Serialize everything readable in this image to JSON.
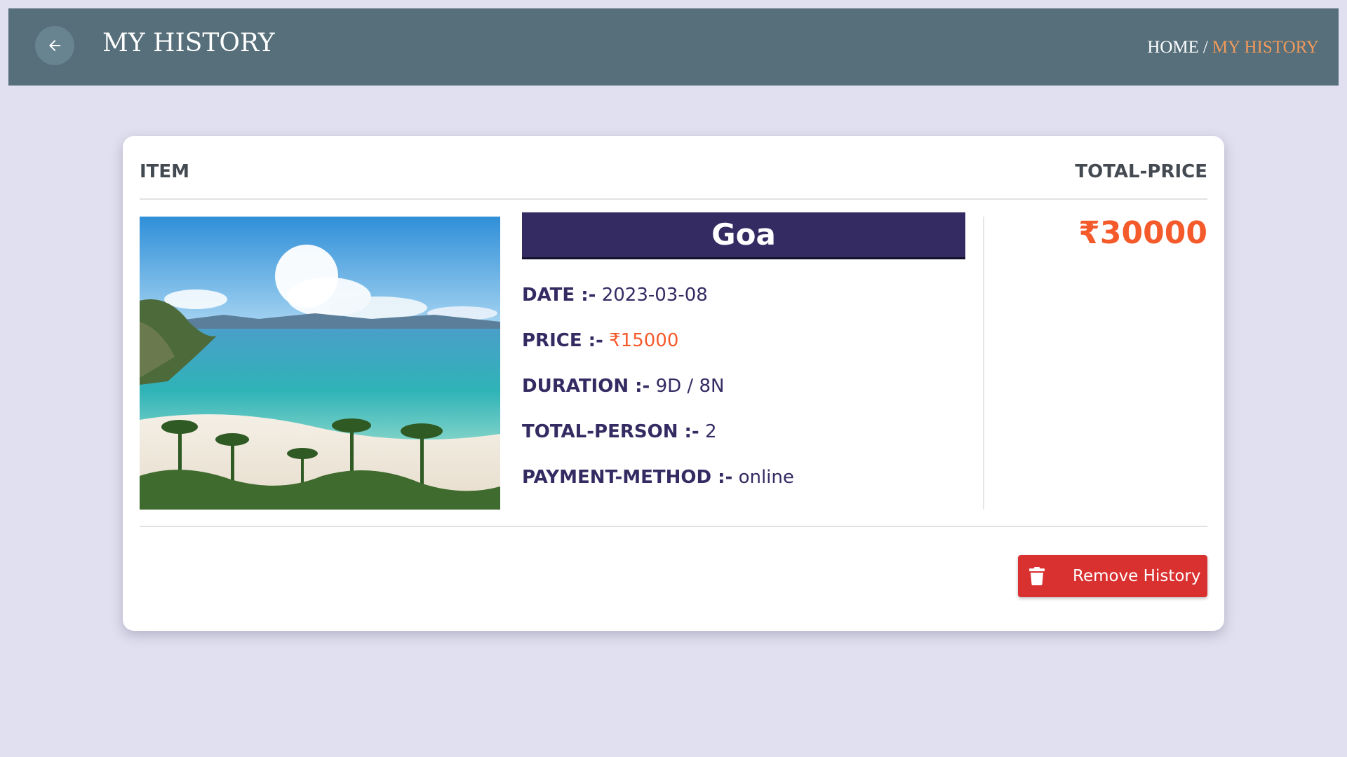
{
  "header": {
    "back_icon": "arrow-left-icon",
    "title": "MY HISTORY",
    "breadcrumb": {
      "home": "HOME",
      "separator": "/",
      "current": "MY HISTORY"
    }
  },
  "table": {
    "col_item": "ITEM",
    "col_total": "TOTAL-PRICE"
  },
  "booking": {
    "image_alt": "beach-photo",
    "destination": "Goa",
    "date_label": "DATE :-",
    "date_value": "2023-03-08",
    "price_label": "PRICE :-",
    "price_value": "₹15000",
    "duration_label": "DURATION :-",
    "duration_value": "9D / 8N",
    "persons_label": "TOTAL-PERSON :-",
    "persons_value": "2",
    "payment_label": "PAYMENT-METHOD :-",
    "payment_value": "online",
    "total_price": "₹30000"
  },
  "actions": {
    "remove_label": "Remove History",
    "remove_icon": "trash-icon"
  },
  "colors": {
    "page_bg": "#e1e0f0",
    "header_bg": "#566f7a",
    "accent_orange": "#f55a2b",
    "breadcrumb_current": "#f29a5b",
    "destination_bar": "#342b63",
    "remove_button": "#d93030"
  }
}
